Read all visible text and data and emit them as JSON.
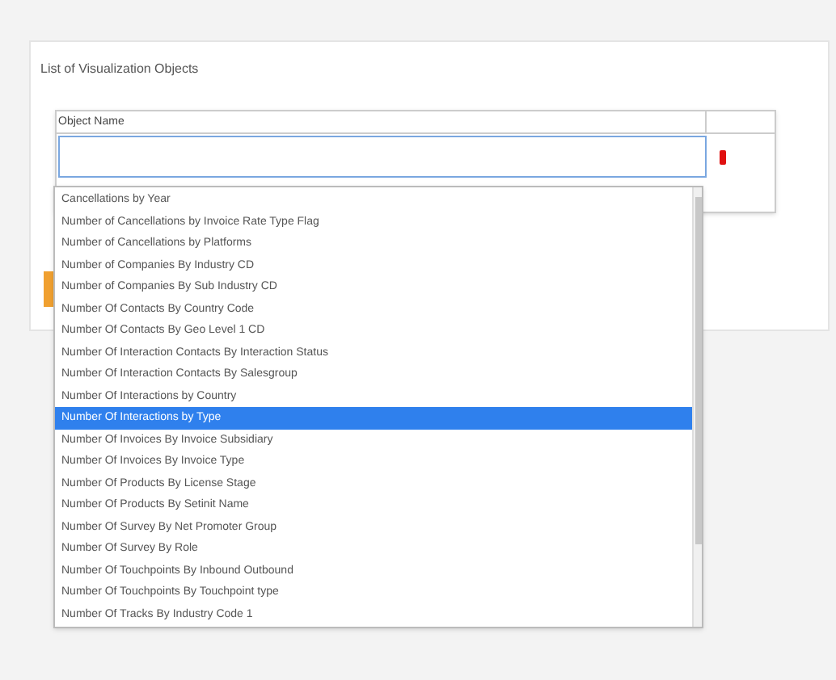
{
  "panel": {
    "title": "List of Visualization Objects"
  },
  "table": {
    "columns": [
      "Object Name"
    ]
  },
  "dropdown": {
    "items": [
      {
        "label": "Cancellations by Year",
        "selected": false
      },
      {
        "label": "Number of Cancellations by Invoice Rate Type Flag",
        "selected": false
      },
      {
        "label": "Number of Cancellations by Platforms",
        "selected": false
      },
      {
        "label": "Number of Companies By Industry CD",
        "selected": false
      },
      {
        "label": "Number of Companies By Sub Industry CD",
        "selected": false
      },
      {
        "label": "Number Of Contacts By Country Code",
        "selected": false
      },
      {
        "label": "Number Of Contacts By Geo Level 1 CD",
        "selected": false
      },
      {
        "label": "Number Of Interaction Contacts By Interaction Status",
        "selected": false
      },
      {
        "label": "Number Of Interaction Contacts By Salesgroup",
        "selected": false
      },
      {
        "label": "Number Of Interactions by Country",
        "selected": false
      },
      {
        "label": "Number Of Interactions by Type",
        "selected": true
      },
      {
        "label": "Number Of Invoices By Invoice Subsidiary",
        "selected": false
      },
      {
        "label": "Number Of Invoices By Invoice Type",
        "selected": false
      },
      {
        "label": "Number Of Products By License Stage",
        "selected": false
      },
      {
        "label": "Number Of Products By Setinit Name",
        "selected": false
      },
      {
        "label": "Number Of Survey By Net Promoter Group",
        "selected": false
      },
      {
        "label": "Number Of Survey By Role",
        "selected": false
      },
      {
        "label": "Number Of Touchpoints By Inbound Outbound",
        "selected": false
      },
      {
        "label": "Number Of Touchpoints By Touchpoint type",
        "selected": false
      },
      {
        "label": "Number Of Tracks By Industry Code 1",
        "selected": false
      }
    ]
  }
}
